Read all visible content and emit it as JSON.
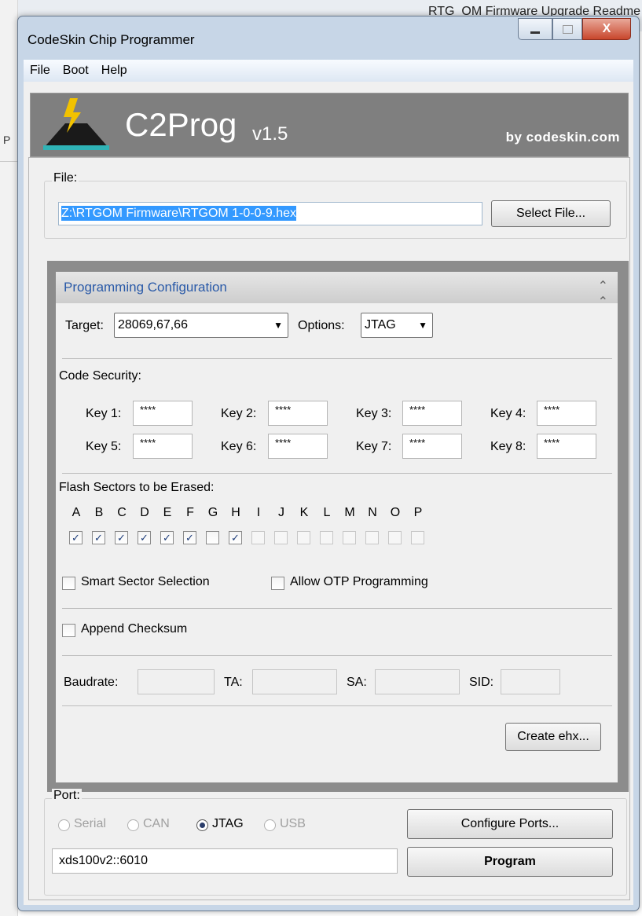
{
  "background": {
    "doc_title": "RTG_OM Firmware Upgrade Readme",
    "left_letter": "P"
  },
  "window": {
    "title": "CodeSkin Chip Programmer",
    "caption_close": "X"
  },
  "menu": [
    "File",
    "Boot",
    "Help"
  ],
  "banner": {
    "title": "C2Prog",
    "version": "v1.5",
    "by": "by codeskin.com"
  },
  "file": {
    "label": "File:",
    "path": "Z:\\RTGOM Firmware\\RTGOM 1-0-0-9.hex",
    "select_button": "Select File..."
  },
  "config": {
    "title": "Programming Configuration",
    "collapse_icon": "˄",
    "target_label": "Target:",
    "target_value": "28069,67,66",
    "options_label": "Options:",
    "options_value": "JTAG",
    "code_security_label": "Code Security:",
    "keys": [
      {
        "label": "Key 1:",
        "value": "****"
      },
      {
        "label": "Key 2:",
        "value": "****"
      },
      {
        "label": "Key 3:",
        "value": "****"
      },
      {
        "label": "Key 4:",
        "value": "****"
      },
      {
        "label": "Key 5:",
        "value": "****"
      },
      {
        "label": "Key 6:",
        "value": "****"
      },
      {
        "label": "Key 7:",
        "value": "****"
      },
      {
        "label": "Key 8:",
        "value": "****"
      }
    ],
    "flash_label": "Flash Sectors to be Erased:",
    "sectors": [
      {
        "letter": "A",
        "checked": true
      },
      {
        "letter": "B",
        "checked": true
      },
      {
        "letter": "C",
        "checked": true
      },
      {
        "letter": "D",
        "checked": true
      },
      {
        "letter": "E",
        "checked": true
      },
      {
        "letter": "F",
        "checked": true
      },
      {
        "letter": "G",
        "checked": false
      },
      {
        "letter": "H",
        "checked": true
      },
      {
        "letter": "I",
        "checked": false
      },
      {
        "letter": "J",
        "checked": false
      },
      {
        "letter": "K",
        "checked": false
      },
      {
        "letter": "L",
        "checked": false
      },
      {
        "letter": "M",
        "checked": false
      },
      {
        "letter": "N",
        "checked": false
      },
      {
        "letter": "O",
        "checked": false
      },
      {
        "letter": "P",
        "checked": false
      }
    ],
    "smart_sector_label": "Smart Sector Selection",
    "allow_otp_label": "Allow OTP Programming",
    "append_checksum_label": "Append Checksum",
    "baudrate_label": "Baudrate:",
    "ta_label": "TA:",
    "sa_label": "SA:",
    "sid_label": "SID:",
    "create_ehx_button": "Create ehx..."
  },
  "port": {
    "label": "Port:",
    "radios": [
      {
        "label": "Serial",
        "selected": false,
        "enabled": false
      },
      {
        "label": "CAN",
        "selected": false,
        "enabled": false
      },
      {
        "label": "JTAG",
        "selected": true,
        "enabled": true
      },
      {
        "label": "USB",
        "selected": false,
        "enabled": false
      }
    ],
    "configure_button": "Configure Ports...",
    "port_value": "xds100v2::6010",
    "program_button": "Program"
  },
  "colors": {
    "title_blue": "#2a5aa8",
    "banner_gray": "#7f7f7f",
    "selection_blue": "#3399ff"
  }
}
